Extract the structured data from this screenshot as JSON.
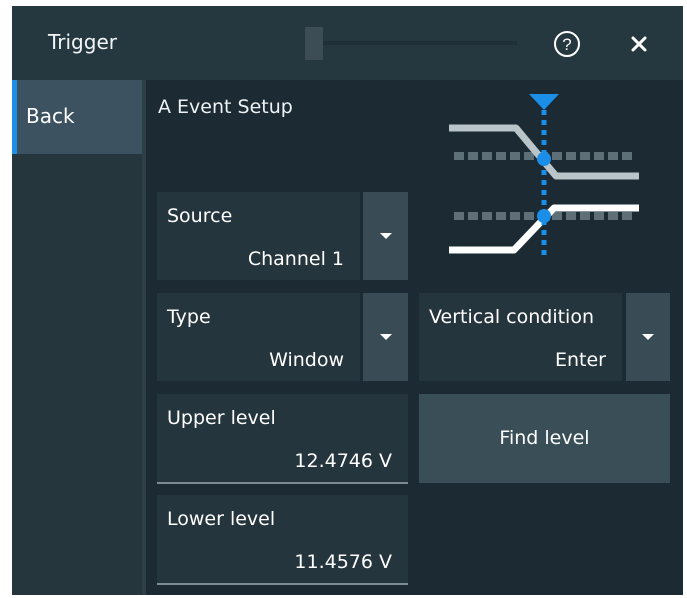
{
  "header": {
    "title": "Trigger",
    "help_icon": "help-circle-icon",
    "close_icon": "close-icon"
  },
  "nav": {
    "back_label": "Back",
    "accent_color": "#1b8fe8"
  },
  "section": {
    "title": "A Event Setup"
  },
  "fields": {
    "source": {
      "label": "Source",
      "value": "Channel 1"
    },
    "type": {
      "label": "Type",
      "value": "Window"
    },
    "vertical_condition": {
      "label": "Vertical condition",
      "value": "Enter"
    },
    "upper_level": {
      "label": "Upper level",
      "value": "12.4746 V"
    },
    "lower_level": {
      "label": "Lower level",
      "value": "11.4576 V"
    }
  },
  "buttons": {
    "find_level": "Find level"
  },
  "diagram": {
    "icon": "window-trigger-diagram-icon"
  }
}
